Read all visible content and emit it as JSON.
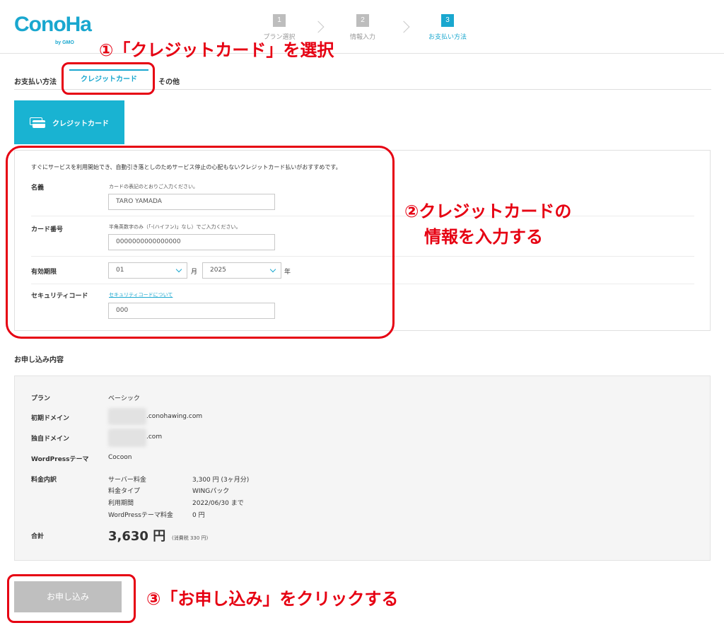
{
  "header": {
    "logo": "ConoHa",
    "logo_sub": "by GMO",
    "steps": [
      {
        "num": "1",
        "label": "プラン選択"
      },
      {
        "num": "2",
        "label": "情報入力"
      },
      {
        "num": "3",
        "label": "お支払い方法"
      }
    ]
  },
  "annotations": {
    "a1": "①「クレジットカード」を選択",
    "a2_line1": "②クレジットカードの",
    "a2_line2": "情報を入力する",
    "a3": "③「お申し込み」をクリックする"
  },
  "payment": {
    "label": "お支払い方法",
    "tabs": [
      "クレジットカード",
      "その他"
    ],
    "card_tile": "クレジットカード"
  },
  "form": {
    "intro": "すぐにサービスを利用開始でき、自動引き落としのためサービス停止の心配もないクレジットカード払いがおすすめです。",
    "name_label": "名義",
    "name_hint": "カードの表記のとおりご入力ください。",
    "name_value": "TARO YAMADA",
    "number_label": "カード番号",
    "number_hint": "半角英数字のみ（「-(ハイフン)」なし）でご入力ください。",
    "number_value": "0000000000000000",
    "expiry_label": "有効期限",
    "month_value": "01",
    "month_unit": "月",
    "year_value": "2025",
    "year_unit": "年",
    "security_label": "セキュリティコード",
    "security_link": "セキュリティコードについて",
    "security_value": "000"
  },
  "summary": {
    "title": "お申し込み内容",
    "plan_label": "プラン",
    "plan_value": "ベーシック",
    "initial_domain_label": "初期ドメイン",
    "initial_domain_suffix": ".conohawing.com",
    "own_domain_label": "独自ドメイン",
    "own_domain_suffix": ".com",
    "theme_label": "WordPressテーマ",
    "theme_value": "Cocoon",
    "fees_label": "料金内訳",
    "fees": [
      {
        "name": "サーバー料金",
        "value": "3,300 円 (3ヶ月分)"
      },
      {
        "name": "料金タイプ",
        "value": "WINGパック"
      },
      {
        "name": "利用期間",
        "value": "2022/06/30 まで"
      },
      {
        "name": "WordPressテーマ料金",
        "value": "0 円"
      }
    ],
    "total_label": "合計",
    "total_value": "3,630 円",
    "tax_note": "(消費税 330 円)"
  },
  "submit_label": "お申し込み",
  "colors": {
    "accent": "#19a7cf",
    "annotation": "#e60012",
    "submit_disabled": "#bfbfbf"
  }
}
